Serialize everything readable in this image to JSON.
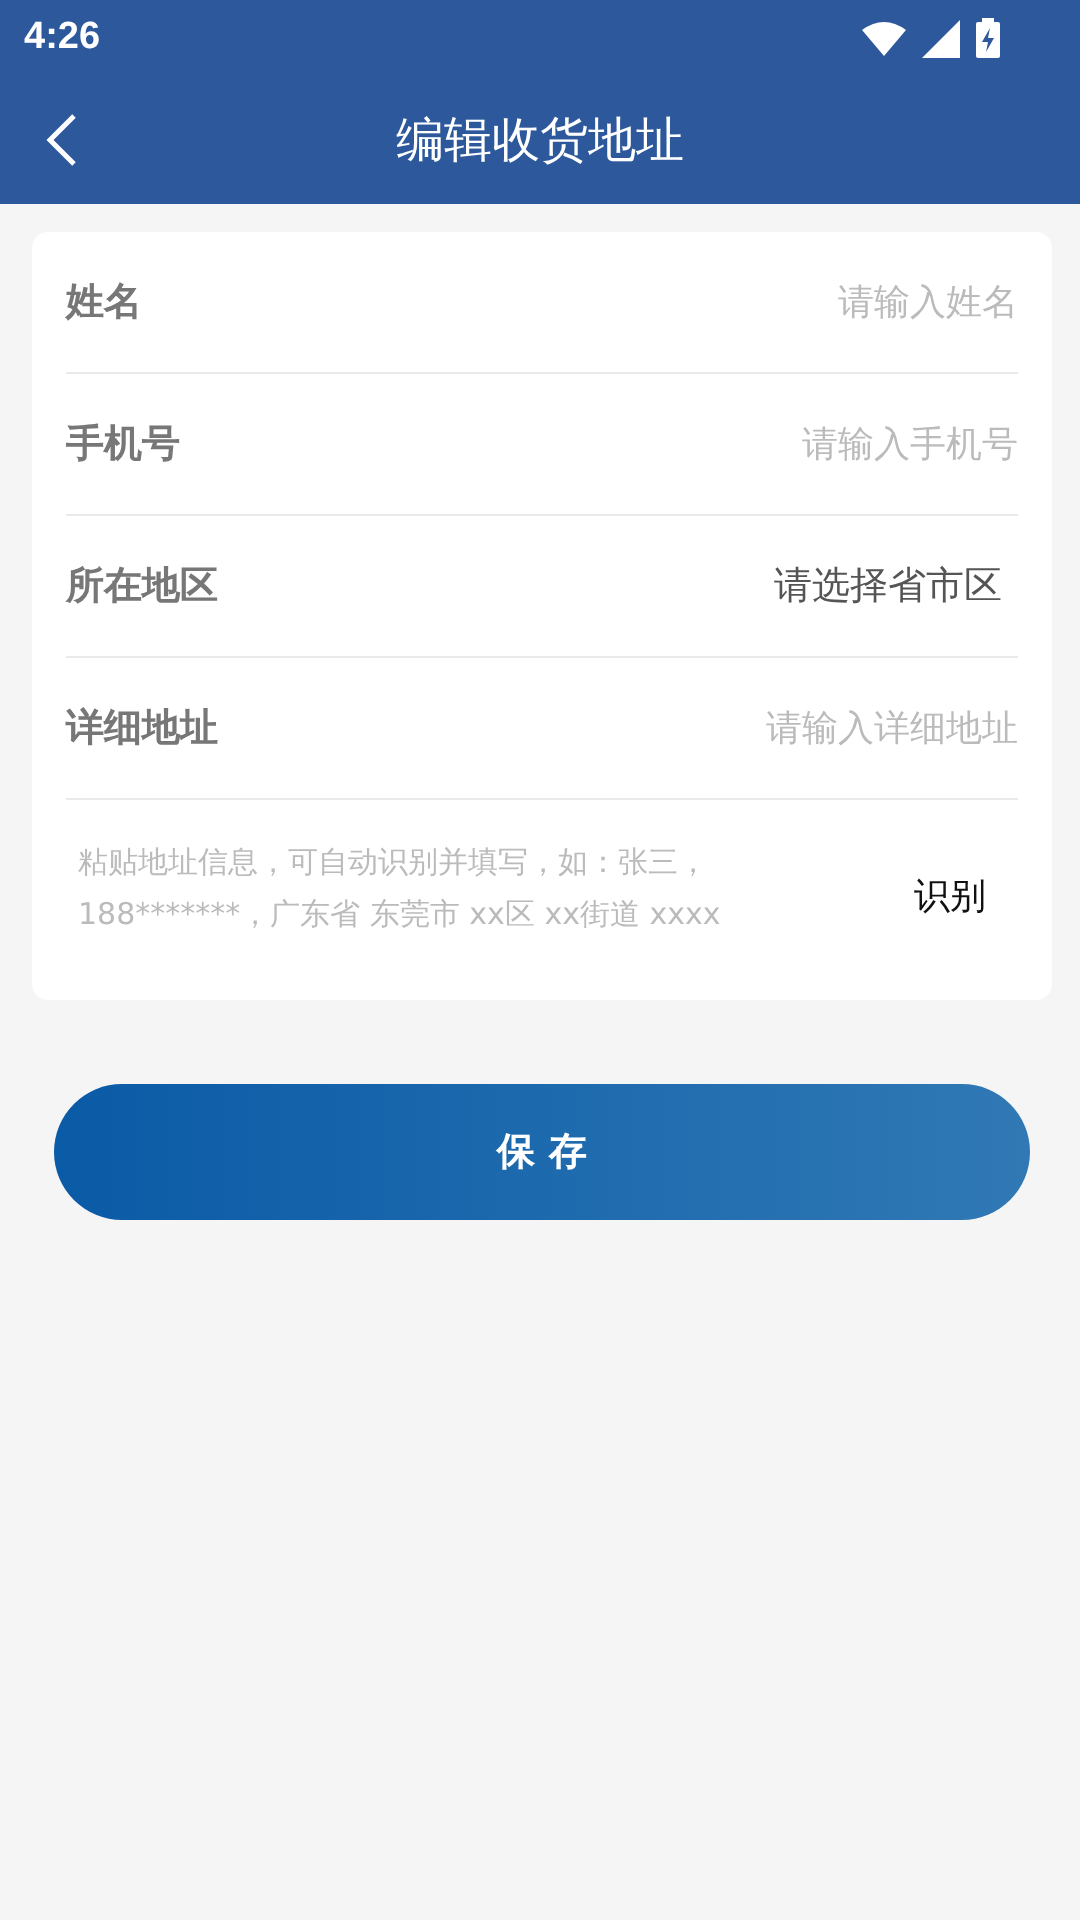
{
  "status_bar": {
    "time": "4:26"
  },
  "toolbar": {
    "title": "编辑收货地址"
  },
  "form": {
    "fields": [
      {
        "kind": "input",
        "label": "姓名",
        "placeholder": "请输入姓名"
      },
      {
        "kind": "input",
        "label": "手机号",
        "placeholder": "请输入手机号"
      },
      {
        "kind": "select",
        "label": "所在地区",
        "value": "请选择省市区"
      },
      {
        "kind": "input",
        "label": "详细地址",
        "placeholder": "请输入详细地址"
      }
    ],
    "paste": {
      "placeholder": "粘贴地址信息，可自动识别并填写，如：张三，188*******，广东省 东莞市 xx区 xx街道 xxxx",
      "button": "识别"
    }
  },
  "save_button": "保 存"
}
